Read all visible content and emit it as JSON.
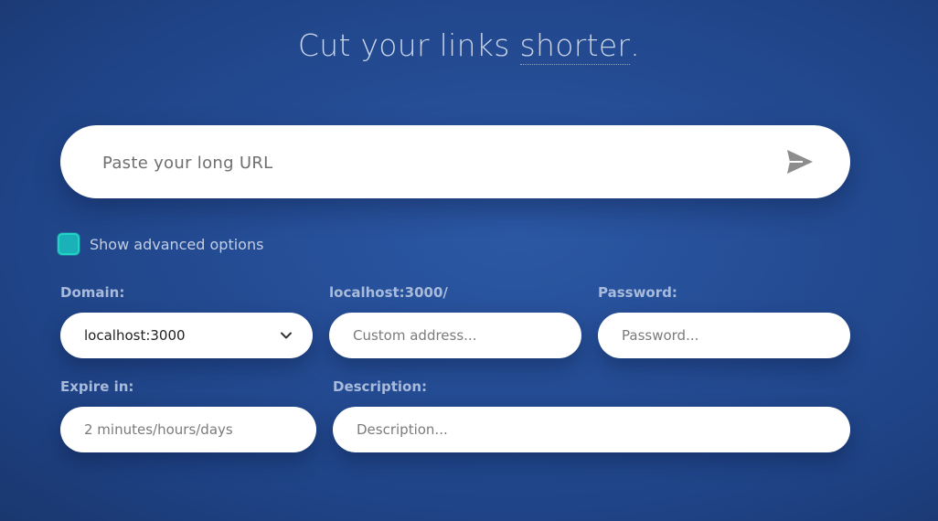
{
  "header": {
    "title_prefix": "Cut your links ",
    "title_accent": "shorter",
    "title_suffix": "."
  },
  "url_input": {
    "placeholder": "Paste your long URL",
    "value": ""
  },
  "send_button": {
    "icon": "send-icon"
  },
  "advanced": {
    "label": "Show advanced options",
    "checked": true,
    "accent_color": "#20d3c4"
  },
  "fields": {
    "domain": {
      "label": "Domain:",
      "selected": "localhost:3000"
    },
    "custom_address": {
      "label": "localhost:3000/",
      "placeholder": "Custom address..."
    },
    "password": {
      "label": "Password:",
      "placeholder": "Password..."
    },
    "expire": {
      "label": "Expire in:",
      "placeholder": "2 minutes/hours/days"
    },
    "description": {
      "label": "Description:",
      "placeholder": "Description..."
    }
  },
  "colors": {
    "background": "#264f98",
    "label": "#a9bbdb",
    "headline": "#c9d4e9"
  }
}
